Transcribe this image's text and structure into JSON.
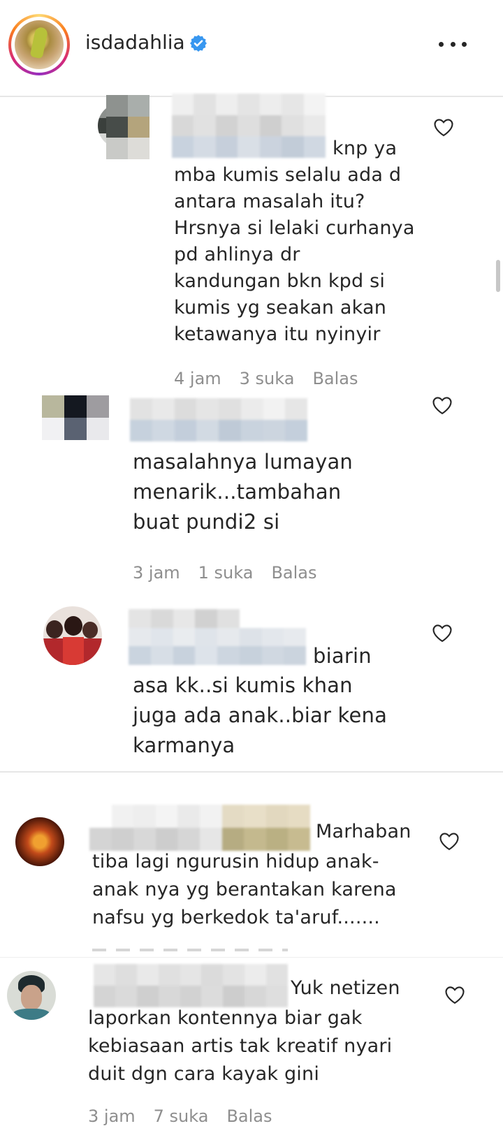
{
  "header": {
    "username": "isdadahlia",
    "verified": true,
    "more_icon": "more-horizontal-icon"
  },
  "comments": [
    {
      "text_first": "knp ya",
      "text_rest": "mba kumis selalu ada d\nantara masalah itu?\nHrsnya si lelaki curhanya\npd ahlinya dr\nkandungan bkn kpd si\nkumis yg seakan akan\nketawanya itu nyinyir",
      "time": "4 jam",
      "likes": "3 suka",
      "reply": "Balas"
    },
    {
      "text": "masalahnya lumayan\nmenarik...tambahan\nbuat pundi2 si",
      "time": "3 jam",
      "likes": "1 suka",
      "reply": "Balas"
    },
    {
      "text_first": "biarin",
      "text_rest": "asa kk..si kumis khan\njuga ada anak..biar kena\nkarmanya"
    },
    {
      "text_first": "Marhaban",
      "text_rest": "tiba lagi ngurusin hidup anak-\nanak nya yg berantakan karena\nnafsu yg berkedok ta'aruf......."
    },
    {
      "text_first": "Yuk netizen",
      "text_rest": "laporkan kontennya biar gak\nkebiasaan artis tak kreatif nyari\nduit dgn cara kayak gini",
      "time": "3 jam",
      "likes": "7 suka",
      "reply": "Balas"
    }
  ],
  "colors": {
    "text": "#262626",
    "meta": "#8e8e8e",
    "verified": "#3897f0",
    "divider": "#e6e6e6"
  }
}
